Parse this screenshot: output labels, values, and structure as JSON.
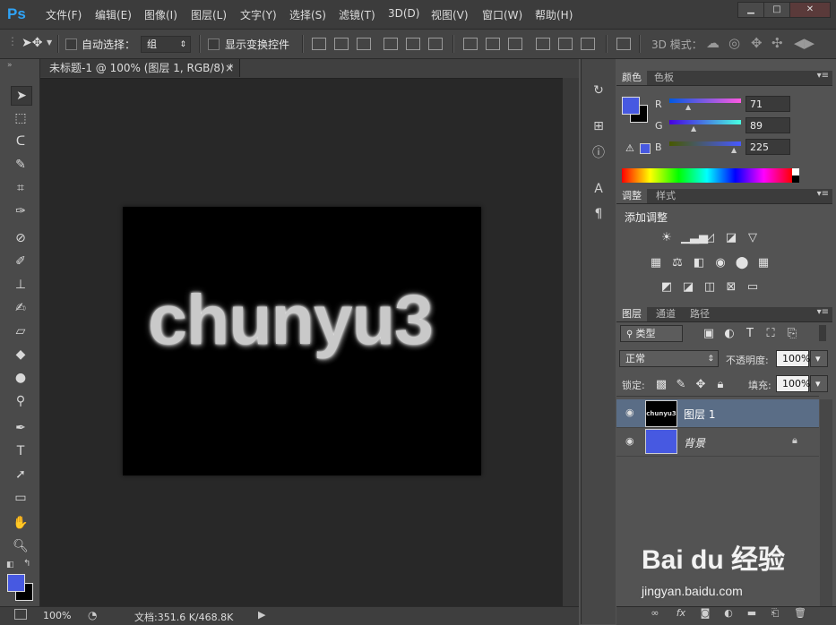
{
  "app": {
    "logo": "Ps"
  },
  "menu": [
    "文件(F)",
    "编辑(E)",
    "图像(I)",
    "图层(L)",
    "文字(Y)",
    "选择(S)",
    "滤镜(T)",
    "3D(D)",
    "视图(V)",
    "窗口(W)",
    "帮助(H)"
  ],
  "window_controls": {
    "minimize": "▁",
    "maximize": "□",
    "close": "✕"
  },
  "options": {
    "auto_select_label": "自动选择：",
    "auto_select_value": "组",
    "show_transform_label": "显示变换控件",
    "mode_3d_label": "3D 模式："
  },
  "document": {
    "tab_title": "未标题-1 @ 100% (图层 1, RGB/8) *",
    "tab_close": "×",
    "canvas_text": "chunyu3"
  },
  "status": {
    "zoom": "100%",
    "doc_info": "文档:351.6 K/468.8K"
  },
  "color_panel": {
    "tabs": [
      "颜色",
      "色板"
    ],
    "channels": [
      {
        "label": "R",
        "value": "71"
      },
      {
        "label": "G",
        "value": "89"
      },
      {
        "label": "B",
        "value": "225"
      }
    ],
    "foreground": "#4759e1",
    "background": "#000000"
  },
  "adjust_panel": {
    "tabs": [
      "调整",
      "样式"
    ],
    "title": "添加调整"
  },
  "layers_panel": {
    "tabs": [
      "图层",
      "通道",
      "路径"
    ],
    "filter_type": "类型",
    "blend_mode": "正常",
    "opacity_label": "不透明度:",
    "opacity_value": "100%",
    "lock_label": "锁定:",
    "fill_label": "填充:",
    "fill_value": "100%",
    "layers": [
      {
        "name": "图层 1",
        "thumb_text": "chunyu3",
        "selected": true
      },
      {
        "name": "背景",
        "selected": false
      }
    ]
  },
  "watermark": {
    "brand": "Bai du 经验",
    "url": "jingyan.baidu.com"
  }
}
